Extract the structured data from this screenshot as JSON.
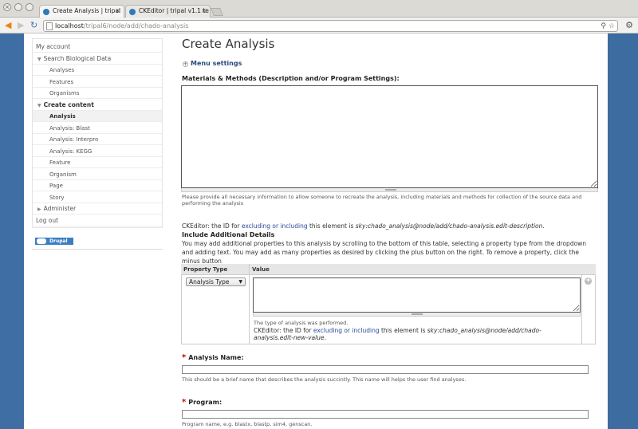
{
  "browser": {
    "tabs": [
      {
        "title": "Create Analysis | tripal",
        "active": true
      },
      {
        "title": "CKEditor | tripal v1.1 te",
        "active": false
      }
    ],
    "url_host": "localhost",
    "url_path": "/tripal6/node/add/chado-analysis",
    "close_glyph": "×",
    "back_icon": "◀",
    "forward_icon": "▶",
    "reload_icon": "↻",
    "zoom_icon": "⚲",
    "star_icon": "☆",
    "wrench_icon": "⚙"
  },
  "sidebar": {
    "items": [
      {
        "label": "My account",
        "level": 1
      },
      {
        "label": "Search Biological Data",
        "level": 1,
        "expanded": true
      },
      {
        "label": "Analyses",
        "level": 2
      },
      {
        "label": "Features",
        "level": 2
      },
      {
        "label": "Organisms",
        "level": 2
      },
      {
        "label": "Create content",
        "level": 1,
        "expanded": true,
        "bold": true
      },
      {
        "label": "Analysis",
        "level": 2,
        "bold": true,
        "selected": true
      },
      {
        "label": "Analysis: Blast",
        "level": 2
      },
      {
        "label": "Analysis: Interpro",
        "level": 2
      },
      {
        "label": "Analysis: KEGG",
        "level": 2
      },
      {
        "label": "Feature",
        "level": 2
      },
      {
        "label": "Organism",
        "level": 2
      },
      {
        "label": "Page",
        "level": 2
      },
      {
        "label": "Story",
        "level": 2
      },
      {
        "label": "Administer",
        "level": 1,
        "collapsed": true
      },
      {
        "label": "Log out",
        "level": 1
      }
    ],
    "arrow_down": "▼",
    "arrow_right": "▶",
    "drupal_badge": "Drupal"
  },
  "main": {
    "title": "Create Analysis",
    "menu_settings": "Menu settings",
    "menu_plus": "+",
    "materials_label": "Materials & Methods (Description and/or Program Settings):",
    "materials_value": "",
    "materials_desc": "Please provide all necessary information to allow someone to recreate the analysis, including materials and methods for collection of the source data and performing the analysis",
    "ckeditor1": {
      "prefix": "CKEditor: the ID for ",
      "link": "excluding or including",
      "middle": " this element is ",
      "id": "sky:chado_analysis@node/add/chado-analysis.edit-description",
      "suffix": "."
    },
    "include_heading": "Include Additional Details",
    "include_desc": "You may add additional properties to this analysis by scrolling to the bottom of this table, selecting a property type from the dropdown and adding text. You may add as many properties as desired by clicking the plus button on the right. To remove a property, click the minus button",
    "prop_table": {
      "col_type": "Property Type",
      "col_value": "Value",
      "selected_type": "Analysis Type",
      "dropdown_arrow": "▼",
      "value_text": "",
      "value_desc": "The type of analysis was performed.",
      "add_glyph": "+",
      "ckeditor2": {
        "prefix": "CKEditor: the ID for ",
        "link": "excluding or including",
        "middle": " this element is ",
        "id": "sky:chado_analysis@node/add/chado-analysis.edit-new-value",
        "suffix": "."
      }
    },
    "analysis_name": {
      "required": "*",
      "label": "Analysis Name:",
      "value": "",
      "desc": "This should be a brief name that describes the analysis succintly. This name will helps the user find analyses."
    },
    "program": {
      "required": "*",
      "label": "Program:",
      "value": "",
      "desc": "Program name, e.g. blastx, blastp, sim4, genscan."
    }
  }
}
